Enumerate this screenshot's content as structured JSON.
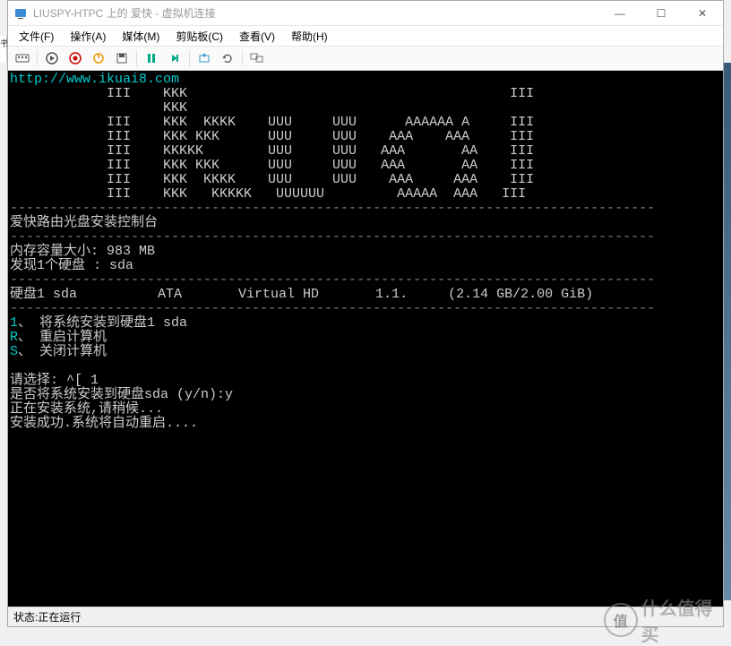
{
  "window": {
    "title": "LIUSPY-HTPC 上的 爱快 - 虚拟机连接",
    "minimize": "—",
    "maximize": "☐",
    "close": "✕"
  },
  "menu": {
    "file": "文件(F)",
    "action": "操作(A)",
    "media": "媒体(M)",
    "clipboard": "剪贴板(C)",
    "view": "查看(V)",
    "help": "帮助(H)"
  },
  "console": {
    "url": "http://www.ikuai8.com",
    "logo": "            III    KKK                                        III\n                   KKK\n            III    KKK  KKKK    UUU     UUU      AAAAAA A     III\n            III    KKK KKK      UUU     UUU    AAA    AAA     III\n            III    KKKKK        UUU     UUU   AAA       AA    III\n            III    KKK KKK      UUU     UUU   AAA       AA    III\n            III    KKK  KKKK    UUU     UUU    AAA     AAA    III\n            III    KKK   KKKKK   UUUUUU         AAAAA  AAA   III",
    "hr1": "--------------------------------------------------------------------------------",
    "console_title": "爱快路由光盘安装控制台",
    "hr2": "--------------------------------------------------------------------------------",
    "mem_label": "内存容量大小: ",
    "mem_value": "983 MB",
    "disk_found_label": "发现1个硬盘 : ",
    "disk_found_value": "sda",
    "hr3": "--------------------------------------------------------------------------------",
    "disk_info": "硬盘1 sda          ATA       Virtual HD       1.1.     (2.14 GB/2.00 GiB)",
    "hr4": "--------------------------------------------------------------------------------",
    "opt1_key": "1",
    "opt1_text": "、 将系统安装到硬盘1 sda",
    "opt2_key": "R",
    "opt2_text": "、 重启计算机",
    "opt3_key": "S",
    "opt3_text": "、 关闭计算机",
    "prompt": "请选择: ^[ 1",
    "confirm": "是否将系统安装到硬盘sda (y/n):y",
    "installing": "正在安装系统,请稍候...",
    "success": "安装成功.系统将自动重启...."
  },
  "status": {
    "label": "状态: ",
    "value": "正在运行"
  },
  "watermark": {
    "circ": "值",
    "text": "什么值得买"
  },
  "left_edge": "书"
}
